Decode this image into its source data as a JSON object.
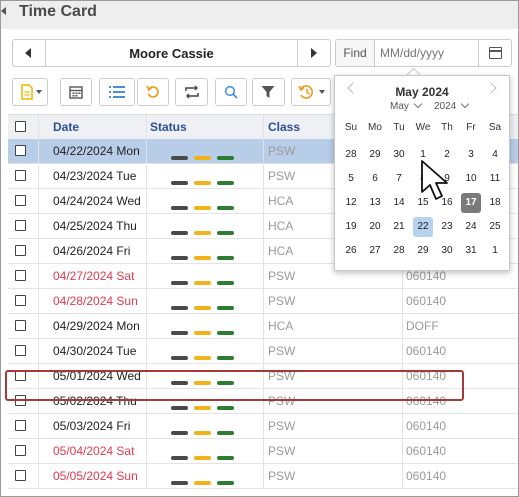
{
  "page_title": "Time Card",
  "employee_nav": {
    "name": "Moore Cassie"
  },
  "find": {
    "label": "Find",
    "placeholder": "MM/dd/yyyy"
  },
  "toolbar": {
    "buttons": [
      {
        "icon": "document-icon"
      },
      {
        "icon": "calendar-icon"
      },
      {
        "icon": "list-icon"
      },
      {
        "icon": "undo-icon"
      },
      {
        "icon": "sync-icon"
      },
      {
        "icon": "search-icon"
      },
      {
        "icon": "filter-icon"
      },
      {
        "icon": "history-icon"
      }
    ]
  },
  "grid": {
    "headers": {
      "date": "Date",
      "status": "Status",
      "class": "Class"
    },
    "status_colors": [
      "#4a4a4a",
      "#f2b21c",
      "#2e7d32"
    ],
    "rows": [
      {
        "date": "04/22/2024 Mon",
        "weekend": false,
        "class": "PSW",
        "code": "",
        "selected": true
      },
      {
        "date": "04/23/2024 Tue",
        "weekend": false,
        "class": "PSW",
        "code": ""
      },
      {
        "date": "04/24/2024 Wed",
        "weekend": false,
        "class": "HCA",
        "code": ""
      },
      {
        "date": "04/25/2024 Thu",
        "weekend": false,
        "class": "HCA",
        "code": ""
      },
      {
        "date": "04/26/2024 Fri",
        "weekend": false,
        "class": "HCA",
        "code": ""
      },
      {
        "date": "04/27/2024 Sat",
        "weekend": true,
        "class": "PSW",
        "code": "060140"
      },
      {
        "date": "04/28/2024 Sun",
        "weekend": true,
        "class": "PSW",
        "code": "060140"
      },
      {
        "date": "04/29/2024 Mon",
        "weekend": false,
        "class": "HCA",
        "code": "DOFF"
      },
      {
        "date": "04/30/2024 Tue",
        "weekend": false,
        "class": "PSW",
        "code": "060140"
      },
      {
        "date": "05/01/2024 Wed",
        "weekend": false,
        "class": "PSW",
        "code": "060140"
      },
      {
        "date": "05/02/2024 Thu",
        "weekend": false,
        "class": "PSW",
        "code": "060140"
      },
      {
        "date": "05/03/2024 Fri",
        "weekend": false,
        "class": "PSW",
        "code": "060140"
      },
      {
        "date": "05/04/2024 Sat",
        "weekend": true,
        "class": "PSW",
        "code": "060140"
      },
      {
        "date": "05/05/2024 Sun",
        "weekend": true,
        "class": "PSW",
        "code": "060140"
      }
    ]
  },
  "calendar": {
    "title": "May 2024",
    "month_select": "May",
    "year_select": "2024",
    "weekdays": [
      "Su",
      "Mo",
      "Tu",
      "We",
      "Th",
      "Fr",
      "Sa"
    ],
    "weeks": [
      [
        "28",
        "29",
        "30",
        "1",
        "2",
        "3",
        "4"
      ],
      [
        "5",
        "6",
        "7",
        "8",
        "9",
        "10",
        "11"
      ],
      [
        "12",
        "13",
        "14",
        "15",
        "16",
        "17",
        "18"
      ],
      [
        "19",
        "20",
        "21",
        "22",
        "23",
        "24",
        "25"
      ],
      [
        "26",
        "27",
        "28",
        "29",
        "30",
        "31",
        "1"
      ]
    ],
    "today": "17",
    "selected": "22"
  }
}
